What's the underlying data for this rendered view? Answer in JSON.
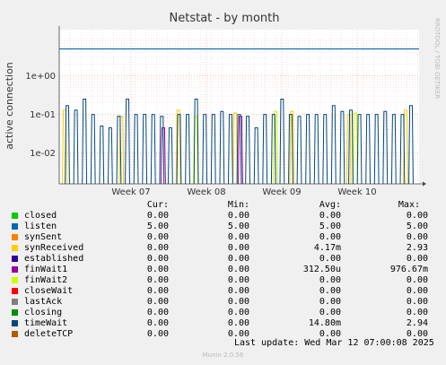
{
  "chart_data": {
    "type": "line",
    "title": "Netstat - by month",
    "ylabel": "active connection",
    "y_scale": "log",
    "y_ticks": [
      "1e+00",
      "1e-01",
      "1e-02"
    ],
    "x_ticks": [
      "Week 07",
      "Week 08",
      "Week 09",
      "Week 10"
    ],
    "side_label": "RRDTOOL / TOBI OETIKER",
    "grid": true,
    "series": [
      {
        "name": "closed",
        "color": "#00cc00",
        "values": [
          0
        ]
      },
      {
        "name": "listen",
        "color": "#0066b3",
        "values": [
          5
        ]
      },
      {
        "name": "synSent",
        "color": "#ff8000",
        "values": [
          0
        ]
      },
      {
        "name": "synReceived",
        "color": "#ffcc00",
        "values": [
          0.13,
          0.09,
          0.13,
          0.11,
          0.12,
          0.1,
          0.13
        ]
      },
      {
        "name": "established",
        "color": "#330099",
        "values": [
          0
        ]
      },
      {
        "name": "finWait1",
        "color": "#990099",
        "values": [
          0.045,
          0.09
        ]
      },
      {
        "name": "finWait2",
        "color": "#ccff00",
        "values": [
          0.09,
          0.12,
          0.11
        ]
      },
      {
        "name": "closeWait",
        "color": "#ff0000",
        "values": [
          0
        ]
      },
      {
        "name": "lastAck",
        "color": "#808080",
        "values": [
          0
        ]
      },
      {
        "name": "closing",
        "color": "#008f00",
        "values": [
          0
        ]
      },
      {
        "name": "timeWait",
        "color": "#00487d",
        "values": [
          0.17,
          0.13,
          0.25,
          0.1,
          0.05,
          0.045,
          0.09,
          0.25,
          0.1,
          0.1,
          0.1,
          0.09,
          0.045,
          0.1,
          0.1,
          0.25,
          0.1,
          0.1,
          0.12,
          0.1,
          0.1,
          0.09,
          0.045,
          0.1,
          0.1,
          0.25,
          0.1,
          0.09,
          0.1,
          0.1,
          0.1,
          0.17,
          0.12,
          0.13,
          0.1,
          0.1,
          0.1,
          0.12,
          0.1,
          0.1,
          0.17
        ]
      },
      {
        "name": "deleteTCP",
        "color": "#b35a00",
        "values": [
          0
        ]
      }
    ]
  },
  "legend": {
    "headers": {
      "cur": "Cur:",
      "min": "Min:",
      "avg": "Avg:",
      "max": "Max:"
    },
    "rows": [
      {
        "name": "closed",
        "color": "#00cc00",
        "cur": "0.00",
        "min": "0.00",
        "avg": "0.00",
        "max": "0.00"
      },
      {
        "name": "listen",
        "color": "#0066b3",
        "cur": "5.00",
        "min": "5.00",
        "avg": "5.00",
        "max": "5.00"
      },
      {
        "name": "synSent",
        "color": "#ff8000",
        "cur": "0.00",
        "min": "0.00",
        "avg": "0.00",
        "max": "0.00"
      },
      {
        "name": "synReceived",
        "color": "#ffcc00",
        "cur": "0.00",
        "min": "0.00",
        "avg": "4.17m",
        "max": "2.93"
      },
      {
        "name": "established",
        "color": "#330099",
        "cur": "0.00",
        "min": "0.00",
        "avg": "0.00",
        "max": "0.00"
      },
      {
        "name": "finWait1",
        "color": "#990099",
        "cur": "0.00",
        "min": "0.00",
        "avg": "312.50u",
        "max": "976.67m"
      },
      {
        "name": "finWait2",
        "color": "#ccff00",
        "cur": "0.00",
        "min": "0.00",
        "avg": "0.00",
        "max": "0.00"
      },
      {
        "name": "closeWait",
        "color": "#ff0000",
        "cur": "0.00",
        "min": "0.00",
        "avg": "0.00",
        "max": "0.00"
      },
      {
        "name": "lastAck",
        "color": "#808080",
        "cur": "0.00",
        "min": "0.00",
        "avg": "0.00",
        "max": "0.00"
      },
      {
        "name": "closing",
        "color": "#008f00",
        "cur": "0.00",
        "min": "0.00",
        "avg": "0.00",
        "max": "0.00"
      },
      {
        "name": "timeWait",
        "color": "#00487d",
        "cur": "0.00",
        "min": "0.00",
        "avg": "14.80m",
        "max": "2.94"
      },
      {
        "name": "deleteTCP",
        "color": "#b35a00",
        "cur": "0.00",
        "min": "0.00",
        "avg": "0.00",
        "max": "0.00"
      }
    ],
    "last_update": "Last update:  Wed Mar 12 07:00:08 2025"
  },
  "footer": "Munin 2.0.56"
}
